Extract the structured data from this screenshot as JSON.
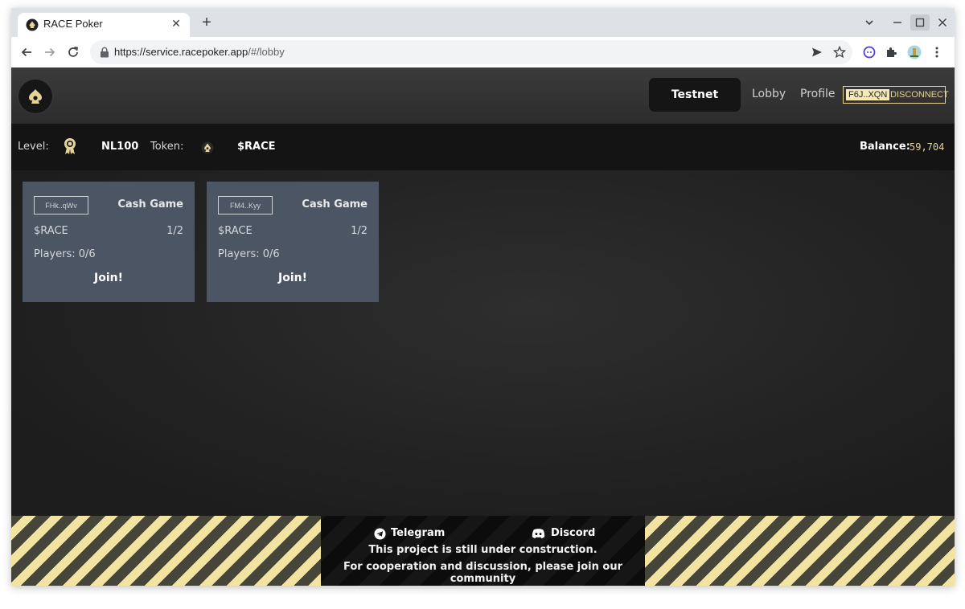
{
  "browser": {
    "tab_title": "RACE Poker",
    "close_glyph": "✕",
    "new_tab_glyph": "+",
    "url_host": "https://service.racepoker.app",
    "url_path": "/#/lobby"
  },
  "header": {
    "network_button": "Testnet",
    "nav": [
      "Lobby",
      "Profile"
    ],
    "wallet_address": "F6J..XQN",
    "disconnect_label": "DISCONNECT"
  },
  "infobar": {
    "level_label": "Level:",
    "level_value": "NL100",
    "token_label": "Token:",
    "token_value": "$RACE",
    "balance_label": "Balance:",
    "balance_value": "59,704"
  },
  "games": [
    {
      "id": "FHk..qWv",
      "type": "Cash Game",
      "token": "$RACE",
      "blinds": "1/2",
      "players": "Players: 0/6",
      "action": "Join!"
    },
    {
      "id": "FM4..Kyy",
      "type": "Cash Game",
      "token": "$RACE",
      "blinds": "1/2",
      "players": "Players: 0/6",
      "action": "Join!"
    }
  ],
  "footer": {
    "telegram_label": "Telegram",
    "discord_label": "Discord",
    "line1": "This project is still under construction.",
    "line2": "For cooperation and discussion, please join our community"
  },
  "colors": {
    "accent_gold": "#e6d39a",
    "card_bg": "#4b5563",
    "stripe_light": "#f2e3a1",
    "stripe_dark": "#454539"
  }
}
